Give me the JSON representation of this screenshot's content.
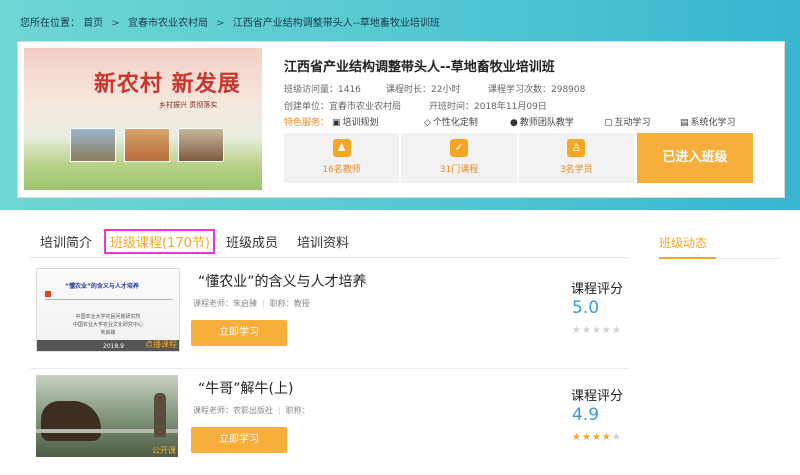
{
  "breadcrumb": {
    "prefix": "您所在位置：",
    "items": [
      "首页",
      "宜春市农业农村局",
      "江西省产业结构调整带头人--草地畜牧业培训班"
    ]
  },
  "banner": {
    "slogan": "新农村  新发展",
    "subtext": "乡村振兴  贯彻落实"
  },
  "class": {
    "title": "江西省产业结构调整带头人--草地畜牧业培训班",
    "visits": "班级访问量：1416",
    "duration": "课程时长：22小时",
    "study_count": "课程学习次数：298908",
    "creator": "创建单位：宜春市农业农村局",
    "open_time": "开班时间：2018年11月09日",
    "features_label": "特色服务：",
    "features": [
      "培训规划",
      "个性化定制",
      "教师团队教学",
      "互动学习",
      "系统化学习"
    ]
  },
  "stats": [
    {
      "label": "16名教师",
      "icon": "teacher-icon"
    },
    {
      "label": "31门课程",
      "icon": "course-icon"
    },
    {
      "label": "3名学员",
      "icon": "student-icon"
    }
  ],
  "enter_button": "已进入班级",
  "tabs": [
    "培训简介",
    "班级课程(170节)",
    "班级成员",
    "培训资料"
  ],
  "side": {
    "title": "班级动态"
  },
  "courses": [
    {
      "title": "“懂农业”的含义与人才培养",
      "teacher": "课程老师：朱启臻",
      "rank": "职称：教授",
      "button": "立即学习",
      "badge": "点播课程",
      "rating_label": "课程评分",
      "rating": "5.0",
      "stars": 0,
      "thumb": {
        "title": "“懂农业”的含义与人才培养",
        "lines": [
          "中国农业大学农民问题研究所",
          "中国农业大学农业文化研究中心",
          "朱启臻"
        ],
        "date": "2018.9"
      }
    },
    {
      "title": "“牛哥”解牛(上)",
      "teacher": "课程老师：农影出版社",
      "rank": "职称：",
      "button": "立即学习",
      "badge": "公开课",
      "rating_label": "课程评分",
      "rating": "4.9",
      "stars": 4
    }
  ],
  "colors": {
    "accent": "#f5a623",
    "hero_start": "#6fd6d4",
    "hero_end": "#37b6cf",
    "rating_blue": "#3a99d8",
    "highlight_box": "#ee33dd"
  }
}
